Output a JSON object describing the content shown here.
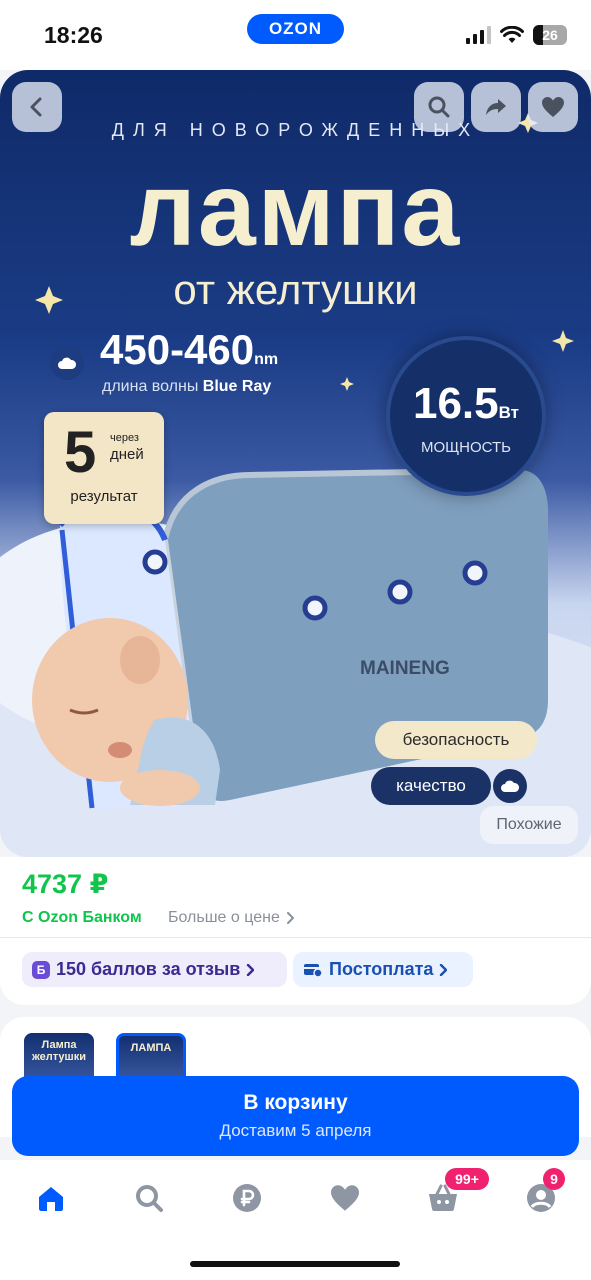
{
  "status_bar": {
    "time": "18:26",
    "logo": "OZON",
    "battery": "26",
    "icons": [
      "signal-icon",
      "wifi-icon",
      "battery-icon"
    ]
  },
  "hero": {
    "buttons": [
      "back-icon",
      "search-icon",
      "share-icon",
      "heart-icon"
    ],
    "kicker": "ДЛЯ НОВОРОЖДЕННЫХ",
    "title": "лампа",
    "subtitle": "от желтушки",
    "wavelength_value": "450-460",
    "wavelength_unit": "nm",
    "wavelength_label": "длина волны",
    "wavelength_label_bold": "Blue Ray",
    "power_value": "16.5",
    "power_unit": "Вт",
    "power_label": "МОЩНОСТЬ",
    "days_number": "5",
    "days_small": "через",
    "days_word": "дней",
    "days_result": "результат",
    "brand": "MAINENG",
    "pill_safety": "безопасность",
    "pill_quality": "качество",
    "similar_button": "Похожие"
  },
  "price": {
    "value": "4737 ₽",
    "bank_label": "С Ozon Банком",
    "more_label": "Больше о цене",
    "bonus_chip": "150 баллов за отзыв",
    "bonus_icon_letter": "Б",
    "postpay_chip": "Постоплата"
  },
  "thumbnails": [
    {
      "text": "Лампа желтушки"
    },
    {
      "text": "ЛАМПА"
    }
  ],
  "cart": {
    "label": "В корзину",
    "delivery": "Доставим 5 апреля"
  },
  "bottom_nav": {
    "items": [
      "home-icon",
      "search-icon",
      "ruble-icon",
      "favorites-icon",
      "cart-icon",
      "profile-icon"
    ],
    "cart_badge": "99+",
    "profile_badge": "9"
  },
  "colors": {
    "brand_blue": "#005bff",
    "price_green": "#10c44c",
    "badge_pink": "#f0216e"
  }
}
